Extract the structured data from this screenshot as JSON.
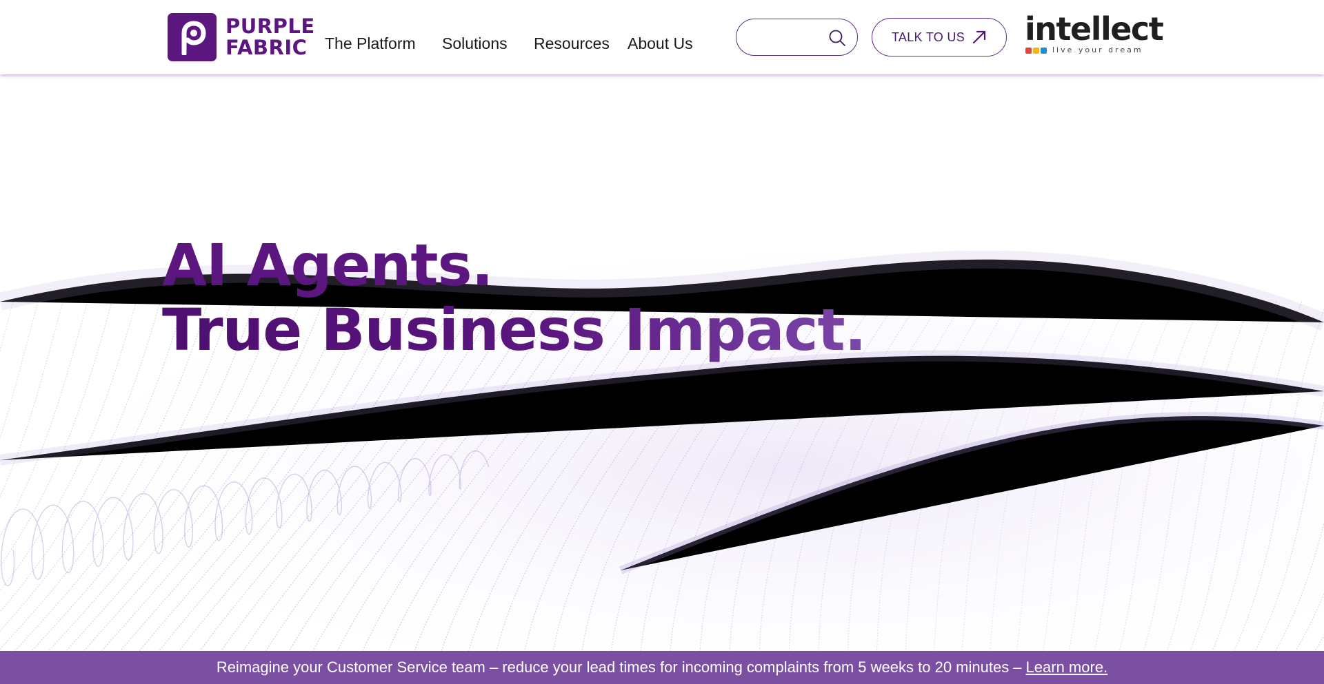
{
  "header": {
    "logo": {
      "line1": "PURPLE",
      "line2": "FABRIC"
    },
    "nav": [
      {
        "label": "The Platform"
      },
      {
        "label": "Solutions"
      },
      {
        "label": "Resources"
      },
      {
        "label": "About Us"
      }
    ],
    "search": {
      "placeholder": "",
      "icon": "search-icon"
    },
    "cta": {
      "label": "TALK TO US",
      "icon": "arrow-up-right-icon"
    },
    "brand": {
      "name": "intellect",
      "tagline": "live your dream",
      "dot_colors": [
        "#e8423c",
        "#f4b51c",
        "#1f8fd6"
      ]
    }
  },
  "hero": {
    "line1": "AI Agents.",
    "line2": "True Business Impact."
  },
  "announcement": {
    "text": "Reimagine your Customer Service team – reduce your lead times for incoming complaints from 5 weeks to 20 minutes –",
    "link": "Learn more."
  },
  "colors": {
    "brand_purple": "#5b1680",
    "banner_purple": "#7b4fa2",
    "wave_lavender": "#b7a6dd"
  }
}
